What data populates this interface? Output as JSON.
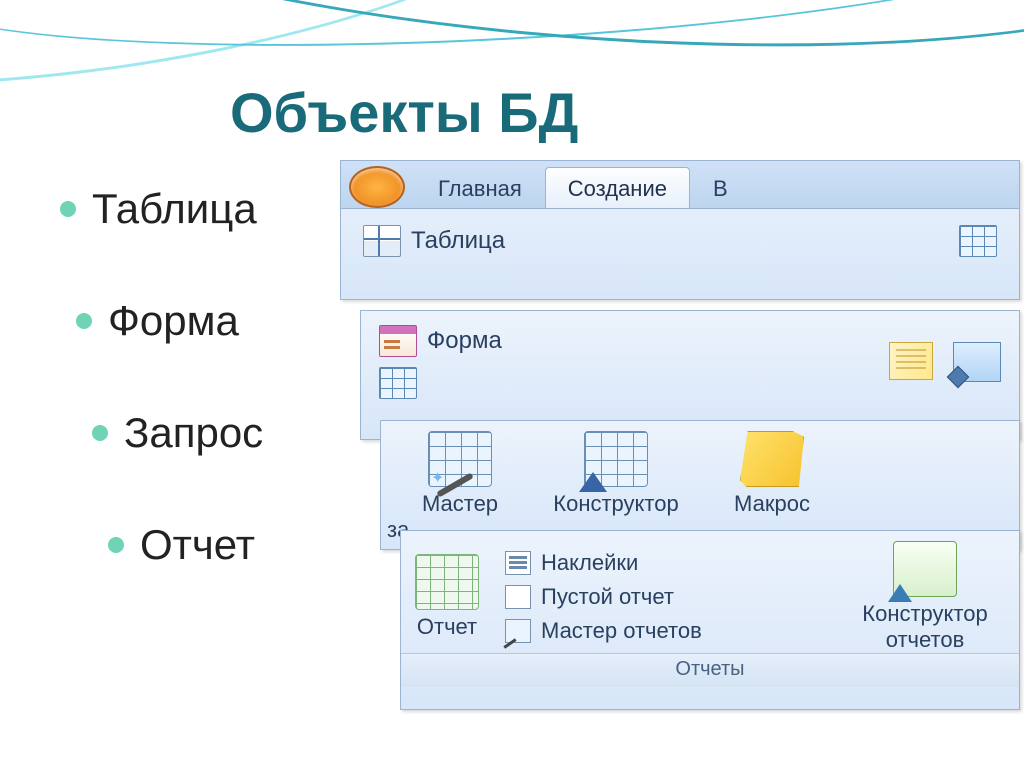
{
  "title": "Объекты БД",
  "bullets": [
    "Таблица",
    "Форма",
    "Запрос",
    "Отчет"
  ],
  "ribbon1": {
    "tab_home": "Главная",
    "tab_create": "Создание",
    "tab_cut": "В",
    "btn_table": "Таблица"
  },
  "ribbon2": {
    "btn_form": "Форма"
  },
  "ribbon3": {
    "btn_master": "Мастер",
    "btn_constructor": "Конструктор",
    "btn_macro": "Макрос",
    "trunc_left": "за"
  },
  "ribbon4": {
    "btn_report": "Отчет",
    "list_labels": "Наклейки",
    "list_blank": "Пустой отчет",
    "list_wizard": "Мастер отчетов",
    "btn_constructor": "Конструктор отчетов",
    "group_label": "Отчеты"
  }
}
